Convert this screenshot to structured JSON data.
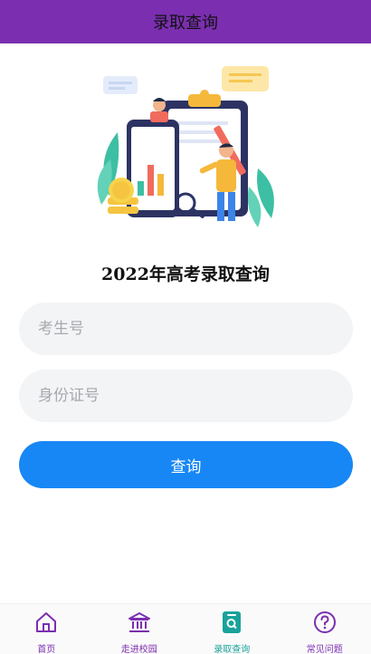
{
  "header": {
    "title": "录取查询"
  },
  "main": {
    "illustration_icon": "admission-query-illustration",
    "headline": "2022年高考录取查询",
    "exam_number_placeholder": "考生号",
    "id_number_placeholder": "身份证号",
    "submit_label": "查询"
  },
  "tabbar": {
    "tabs": [
      {
        "label": "首页",
        "icon": "home-icon"
      },
      {
        "label": "走进校园",
        "icon": "campus-building-icon"
      },
      {
        "label": "录取查询",
        "icon": "query-document-icon",
        "active": true
      },
      {
        "label": "常见问题",
        "icon": "question-icon"
      }
    ],
    "inactive_color": "#7b2fb0",
    "active_color": "#1aa29a"
  },
  "colors": {
    "header_bg": "#7b2fb0",
    "button_bg": "#1787f5",
    "input_bg": "#f3f4f6"
  }
}
